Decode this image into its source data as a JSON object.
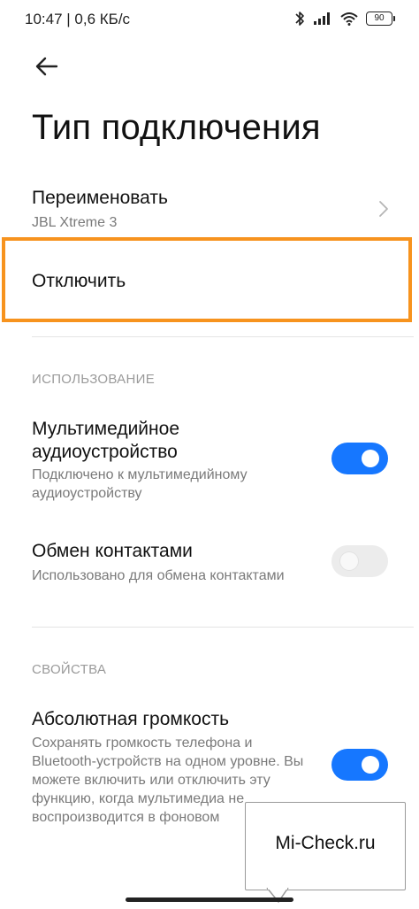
{
  "status_bar": {
    "time_speed": "10:47 | 0,6 КБ/с",
    "battery": "90"
  },
  "header": {
    "back_icon": "arrow-left-icon",
    "title": "Тип подключения"
  },
  "rename": {
    "label": "Переименовать",
    "device_name": "JBL Xtreme 3"
  },
  "disconnect": {
    "label": "Отключить",
    "highlight_color": "#f7931e"
  },
  "usage_section": {
    "header": "ИСПОЛЬЗОВАНИЕ",
    "media": {
      "title": "Мультимедийное аудиоустройство",
      "subtitle": "Подключено к мультимедийному аудиоустройству",
      "enabled": true
    },
    "contacts": {
      "title": "Обмен контактами",
      "subtitle": "Использовано для обмена контактами",
      "enabled": false
    }
  },
  "properties_section": {
    "header": "СВОЙСТВА",
    "absolute_volume": {
      "title": "Абсолютная громкость",
      "subtitle": "Сохранять громкость телефона и Bluetooth-устройств на одном уровне. Вы можете включить или отключить эту функцию, когда мультимедиа не воспроизводится в фоновом",
      "enabled": true
    }
  },
  "watermark": {
    "text": "Mi-Check.ru"
  },
  "colors": {
    "accent": "#1677ff",
    "toggle_off": "#ececec"
  }
}
